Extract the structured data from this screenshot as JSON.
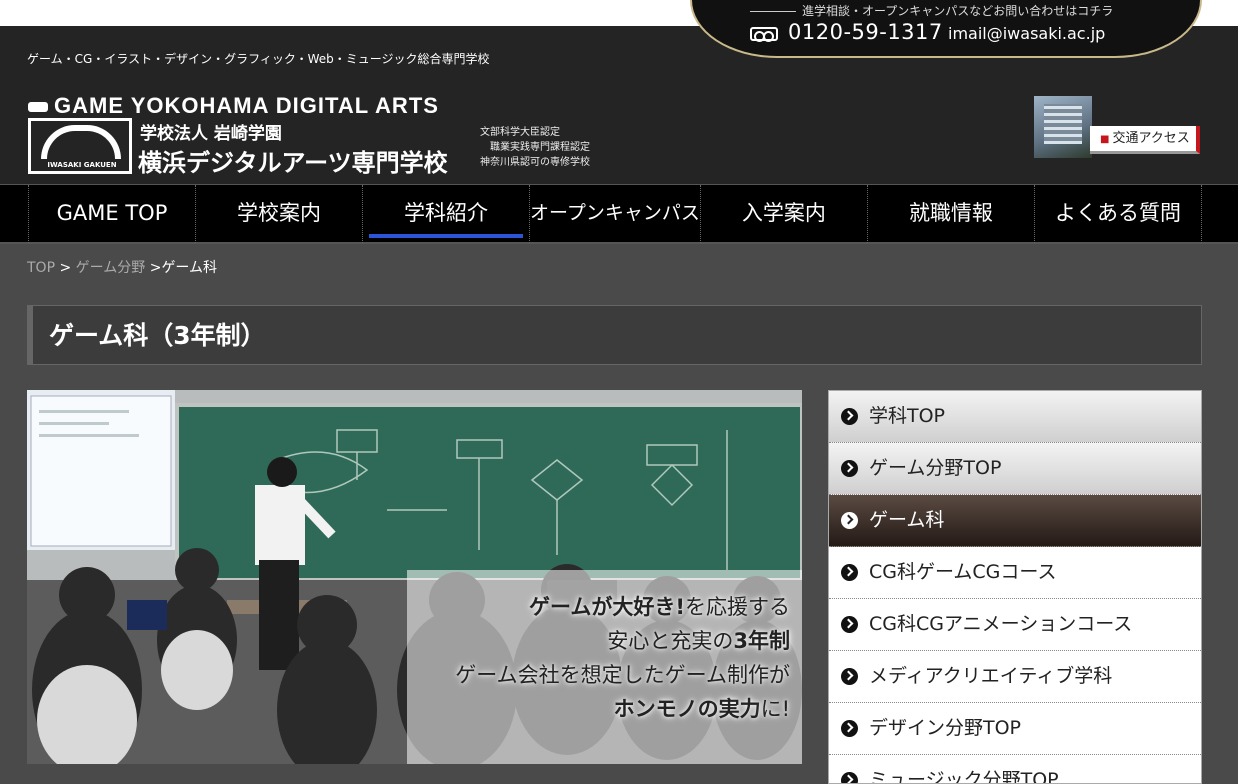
{
  "contact": {
    "lead": "進学相談・オープンキャンパスなどお問い合わせはコチラ",
    "phone": "0120-59-1317",
    "email": "imail@iwasaki.ac.jp"
  },
  "header": {
    "tagline": "ゲーム・CG・イラスト・デザイン・グラフィック・Web・ミュージック総合専門学校",
    "logo_en": "GAME YOKOHAMA DIGITAL ARTS",
    "emblem_text": "IWASAKI GAKUEN",
    "logo_org": "学校法人 岩崎学園",
    "logo_school": "横浜デジタルアーツ専門学校",
    "cert_lines": [
      "文部科学大臣認定",
      "職業実践専門課程認定",
      "神奈川県認可の専修学校"
    ],
    "access_label": "交通アクセス"
  },
  "nav": {
    "items": [
      "GAME TOP",
      "学校案内",
      "学科紹介",
      "オープンキャンパス",
      "入学案内",
      "就職情報",
      "よくある質問"
    ],
    "active_index": 2
  },
  "breadcrumb": {
    "top": "TOP",
    "sep1": ">",
    "field": "ゲーム分野",
    "sep2": ">",
    "current": "ゲーム科"
  },
  "page": {
    "title": "ゲーム科（3年制）"
  },
  "hero": {
    "line1_bold": "ゲームが大好き!",
    "line1_rest": "を応援する",
    "line2_rest": "安心と充実の",
    "line2_bold": "3年制",
    "line3": "ゲーム会社を想定したゲーム制作が",
    "line4_bold": "ホンモノの実力",
    "line4_rest": "に!"
  },
  "sidebar": {
    "items": [
      "学科TOP",
      "ゲーム分野TOP",
      "ゲーム科",
      "CG科ゲームCGコース",
      "CG科CGアニメーションコース",
      "メディアクリエイティブ学科",
      "デザイン分野TOP",
      "ミュージック分野TOP"
    ],
    "active_index": 2
  },
  "colors": {
    "accent_blue": "#2b55d6",
    "access_red": "#c4161c",
    "gold_border": "#c9b98a"
  }
}
